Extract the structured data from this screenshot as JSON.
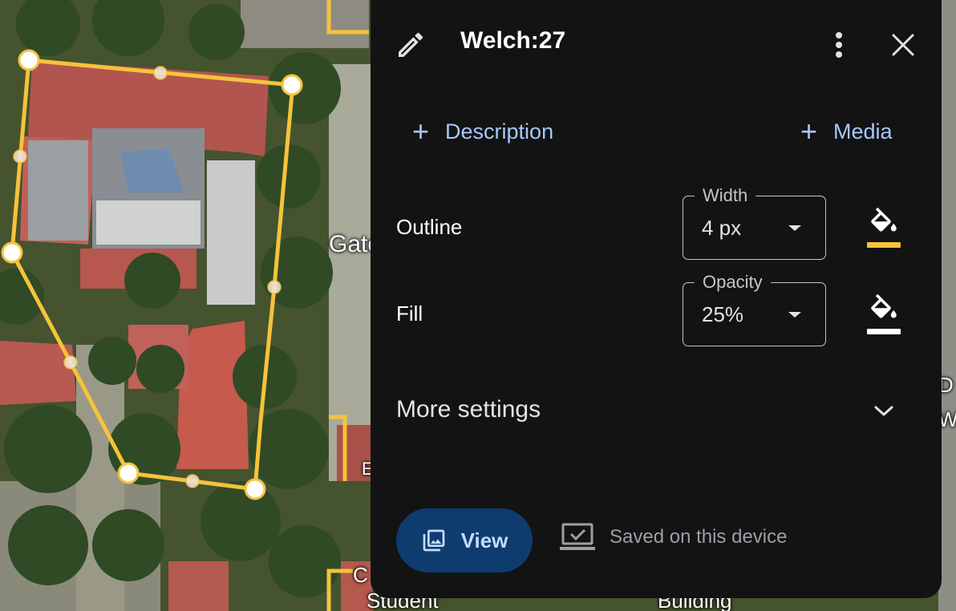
{
  "map": {
    "labels": [
      "Gate",
      "E",
      "C",
      "Student",
      "Building",
      "D",
      "W"
    ]
  },
  "panel": {
    "title": "Welch:27",
    "actions": {
      "description_label": "Description",
      "media_label": "Media"
    },
    "outline": {
      "label": "Outline",
      "width_legend": "Width",
      "width_value": "4 px",
      "color": "#f5c33b"
    },
    "fill": {
      "label": "Fill",
      "opacity_legend": "Opacity",
      "opacity_value": "25%",
      "color": "#ffffff"
    },
    "more_settings_label": "More settings",
    "view_button_label": "View",
    "saved_status": "Saved on this device",
    "icons": [
      "edit-icon",
      "more-vert-icon",
      "close-icon",
      "plus-icon",
      "paint-bucket-icon",
      "chevron-down-icon",
      "photo-library-icon",
      "laptop-check-icon"
    ]
  }
}
